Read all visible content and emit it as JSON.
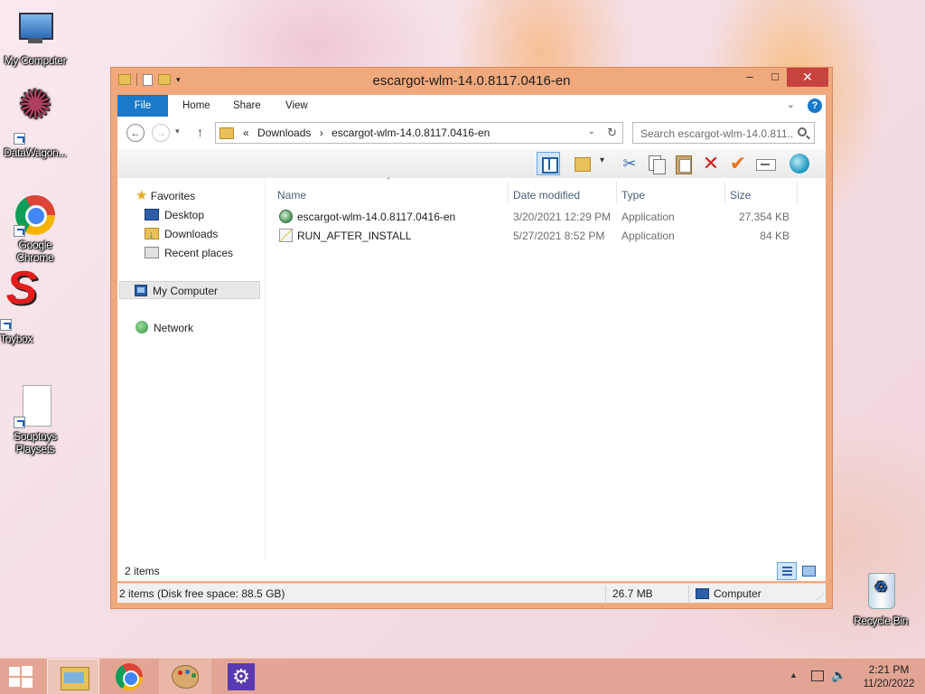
{
  "desktop": {
    "icons": [
      {
        "label": "My Computer",
        "icon": "computer-icon"
      },
      {
        "label": "DataWagon...",
        "icon": "datawagon-icon"
      },
      {
        "label": "Google Chrome",
        "icon": "chrome-icon"
      },
      {
        "label": "Toybox",
        "icon": "toybox-icon"
      },
      {
        "label": "Souptoys Playsets",
        "icon": "file-icon"
      },
      {
        "label": "Recycle Bin",
        "icon": "recycle-bin-icon"
      }
    ]
  },
  "window": {
    "title": "escargot-wlm-14.0.8117.0416-en",
    "controls": {
      "minimize": "‒",
      "maximize": "□",
      "close": "✕"
    },
    "ribbon_tabs": [
      "File",
      "Home",
      "Share",
      "View"
    ],
    "address": {
      "prefix": "«",
      "crumbs": [
        "Downloads",
        "›",
        "escargot-wlm-14.0.8117.0416-en"
      ]
    },
    "search_placeholder": "Search escargot-wlm-14.0.811...",
    "nav_pane": {
      "favorites": "Favorites",
      "favorites_items": [
        "Desktop",
        "Downloads",
        "Recent places"
      ],
      "my_computer": "My Computer",
      "network": "Network"
    },
    "columns": {
      "name": "Name",
      "date": "Date modified",
      "type": "Type",
      "size": "Size"
    },
    "files": [
      {
        "name": "escargot-wlm-14.0.8117.0416-en",
        "date": "3/20/2021 12:29 PM",
        "type": "Application",
        "size": "27,354 KB"
      },
      {
        "name": "RUN_AFTER_INSTALL",
        "date": "5/27/2021 8:52 PM",
        "type": "Application",
        "size": "84 KB"
      }
    ],
    "item_count": "2 items",
    "status_bar": {
      "summary": "2 items (Disk free space: 88.5 GB)",
      "size": "26.7 MB",
      "location": "Computer"
    }
  },
  "taskbar": {
    "apps": [
      "File Explorer",
      "Google Chrome",
      "Paint",
      "Settings"
    ],
    "clock": {
      "time": "2:21 PM",
      "date": "11/20/2022"
    }
  },
  "colors": {
    "accent": "#1979ca",
    "window_frame": "#f0a97c",
    "close_button": "#c7433f"
  }
}
